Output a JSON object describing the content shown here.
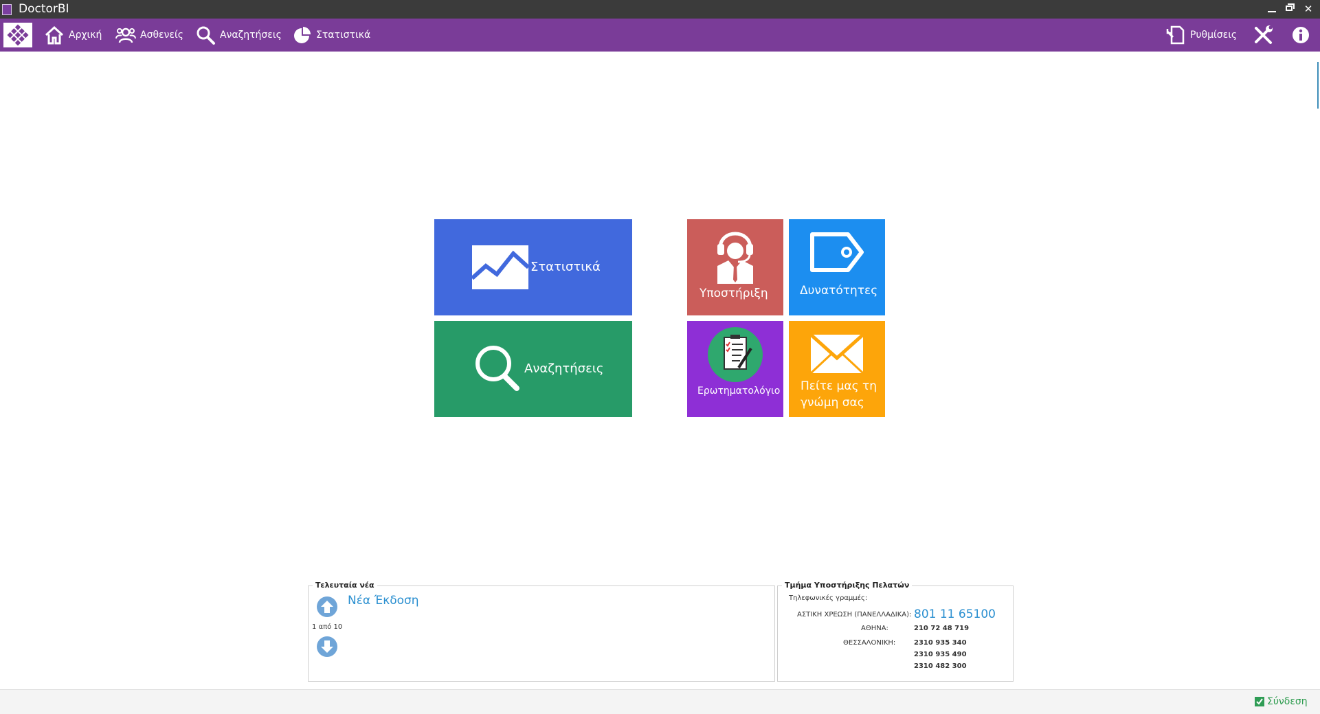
{
  "window": {
    "title": "DoctorBI"
  },
  "nav": {
    "home": "Αρχική",
    "patients": "Ασθενείς",
    "searches": "Αναζητήσεις",
    "statistics": "Στατιστικά",
    "settings": "Ρυθμίσεις"
  },
  "tiles": {
    "statistics": "Στατιστικά",
    "searches": "Αναζητήσεις",
    "support": "Υποστήριξη",
    "features": "Δυνατότητες",
    "questionnaire": "Ερωτηματολόγιο",
    "opinion_line1": "Πείτε μας τη",
    "opinion_line2": "γνώμη σας"
  },
  "news": {
    "title": "Τελευταία νέα",
    "item": "Νέα Έκδοση",
    "pager": "1 από 10"
  },
  "support": {
    "title": "Τμήμα Υποστήριξης Πελατών",
    "phones_label": "Τηλεφωνικές γραμμές:",
    "local_label": "ΑΣΤΙΚΗ ΧΡΕΩΣΗ (ΠΑΝΕΛΛΑΔΙΚΑ):",
    "local_number": "801 11 65100",
    "athens_label": "ΑΘΗΝΑ:",
    "athens_number": "210 72 48 719",
    "thess_label": "ΘΕΣΣΑΛΟΝΙΚΗ:",
    "thess_numbers": [
      "2310 935 340",
      "2310 935 490",
      "2310 482 300"
    ]
  },
  "status": {
    "login": "Σύνδεση"
  },
  "colors": {
    "nav_bg": "#7a3c98",
    "tile_stats": "#4169dd",
    "tile_search": "#279b68",
    "tile_support": "#cb5d5a",
    "tile_features": "#1c8ef0",
    "tile_questionnaire": "#8e2fd6",
    "tile_opinion": "#fda50a"
  }
}
